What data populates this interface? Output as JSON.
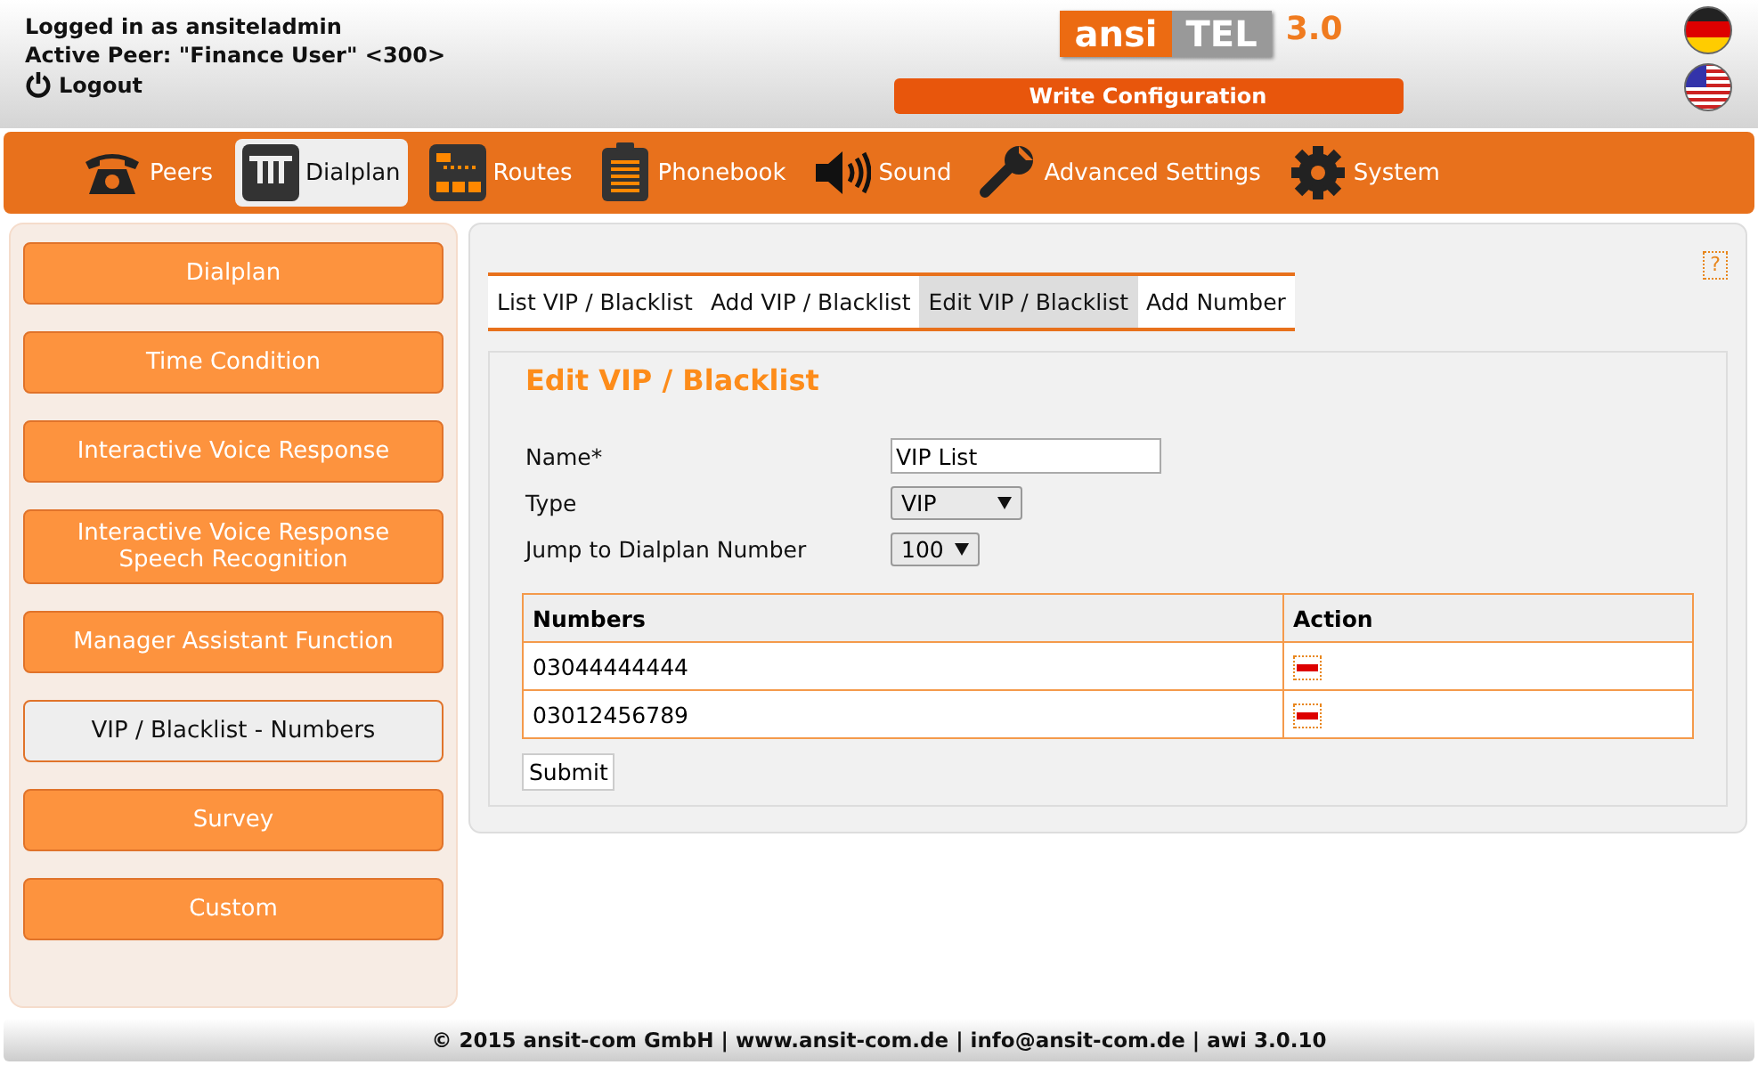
{
  "header": {
    "login": "Logged in as ansiteladmin",
    "peer": "Active Peer: \"Finance User\" <300>",
    "logout": "Logout",
    "logo": {
      "left": "ansi",
      "right": "TEL",
      "version": "3.0"
    },
    "write_button": "Write Configuration"
  },
  "languages": [
    {
      "kind": "de"
    },
    {
      "kind": "us"
    }
  ],
  "nav": [
    {
      "label": "Peers",
      "selected": false
    },
    {
      "label": "Dialplan",
      "selected": true
    },
    {
      "label": "Routes",
      "selected": false
    },
    {
      "label": "Phonebook",
      "selected": false
    },
    {
      "label": "Sound",
      "selected": false
    },
    {
      "label": "Advanced Settings",
      "selected": false
    },
    {
      "label": "System",
      "selected": false
    }
  ],
  "sidebar": {
    "items": [
      {
        "label": "Dialplan",
        "selected": false
      },
      {
        "label": "Time Condition",
        "selected": false
      },
      {
        "label": "Interactive Voice Response",
        "selected": false
      },
      {
        "label": "Interactive Voice Response\nSpeech Recognition",
        "selected": false
      },
      {
        "label": "Manager Assistant Function",
        "selected": false
      },
      {
        "label": "VIP / Blacklist - Numbers",
        "selected": true
      },
      {
        "label": "Survey",
        "selected": false
      },
      {
        "label": "Custom",
        "selected": false
      }
    ]
  },
  "help": "?",
  "tabs": [
    {
      "label": "List VIP / Blacklist",
      "selected": false
    },
    {
      "label": "Add VIP / Blacklist",
      "selected": false
    },
    {
      "label": "Edit VIP / Blacklist",
      "selected": true
    },
    {
      "label": "Add Number",
      "selected": false
    }
  ],
  "form": {
    "title": "Edit VIP / Blacklist",
    "fields": [
      {
        "kind": "text",
        "label": "Name*",
        "value": "VIP List"
      },
      {
        "kind": "select",
        "label": "Type",
        "value": "VIP"
      },
      {
        "kind": "select",
        "label": "Jump to Dialplan Number",
        "value": "100"
      }
    ],
    "table": {
      "columns": [
        "Numbers",
        "Action"
      ],
      "rows": [
        {
          "number": "03044444444"
        },
        {
          "number": "03012456789"
        }
      ]
    },
    "submit": "Submit"
  },
  "footer": "© 2015 ansit-com GmbH | www.ansit-com.de | info@ansit-com.de | awi 3.0.10"
}
